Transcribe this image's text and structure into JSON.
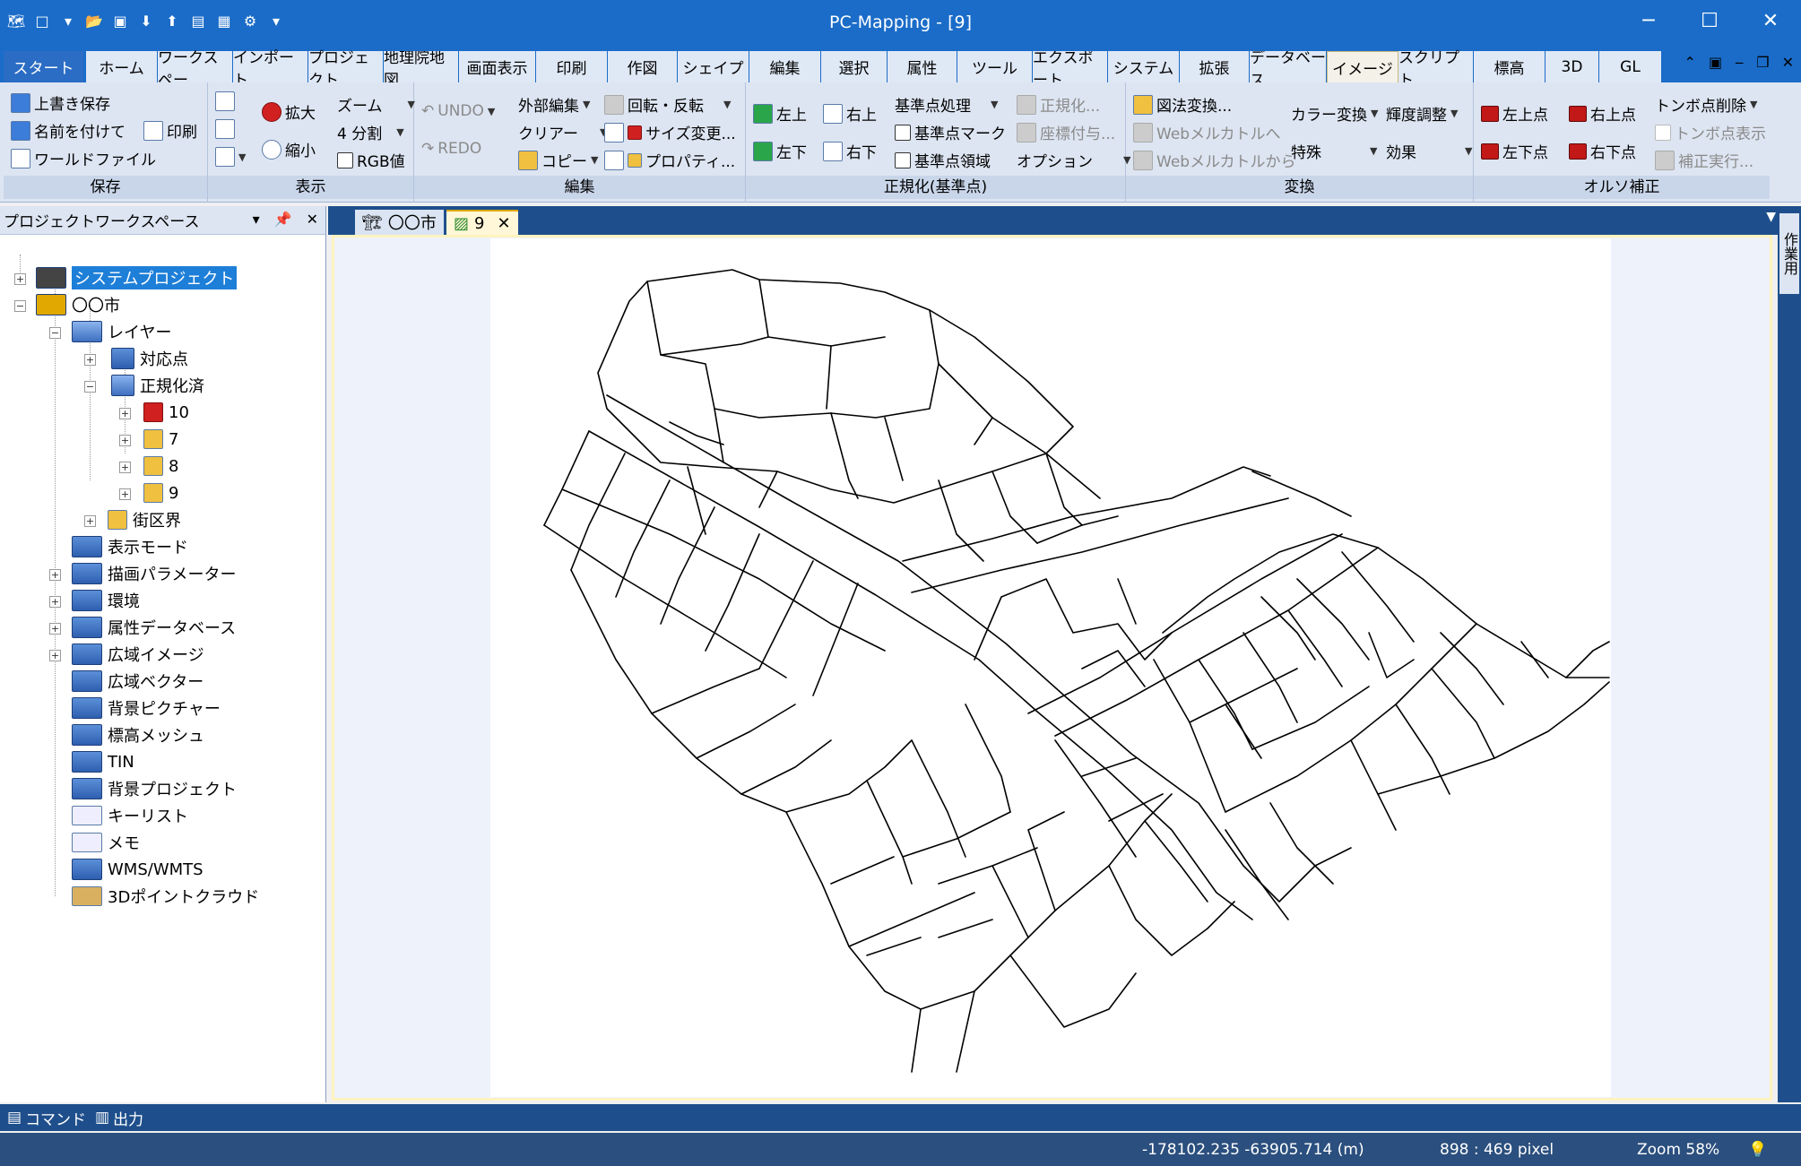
{
  "window": {
    "title": "PC-Mapping - [9]",
    "minimize": "─",
    "maximize": "☐",
    "close": "✕"
  },
  "ribbon_tabs": [
    "スタート",
    "ホーム",
    "ワークスペー",
    "インポート",
    "プロジェクト",
    "地理院地図",
    "画面表示",
    "印刷",
    "作図",
    "シェイプ",
    "編集",
    "選択",
    "属性",
    "ツール",
    "エクスポート",
    "システム",
    "拡張",
    "データベース",
    "イメージ",
    "スクリプト",
    "標高",
    "3D",
    "GL"
  ],
  "ribbon": {
    "save": {
      "title": "保存",
      "overwrite": "上書き保存",
      "save_as": "名前を付けて",
      "world_file": "ワールドファイル",
      "print": "印刷"
    },
    "display": {
      "title": "表示",
      "zoom_in": "拡大",
      "zoom_out": "縮小",
      "zoom": "ズーム",
      "split": "4 分割",
      "rgb": "RGB値"
    },
    "edit": {
      "title": "編集",
      "undo": "UNDO",
      "redo": "REDO",
      "external_edit": "外部編集",
      "clear": "クリアー",
      "copy": "コピー",
      "rotate": "回転・反転",
      "resize": "サイズ変更...",
      "property": "プロパティ..."
    },
    "normalize": {
      "title": "正規化(基準点)",
      "top_left": "左上",
      "bottom_left": "左下",
      "top_right": "右上",
      "bottom_right": "右下",
      "ref_processing": "基準点処理",
      "ref_mark": "基準点マーク",
      "ref_area": "基準点領域",
      "normalize": "正規化...",
      "coord_assign": "座標付与...",
      "option": "オプション"
    },
    "convert": {
      "title": "変換",
      "projection": "図法変換...",
      "to_web_mercator": "Webメルカトルへ",
      "from_web_mercator": "Webメルカトルから",
      "color_convert": "カラー変換",
      "special": "特殊",
      "brightness": "輝度調整",
      "effect": "効果"
    },
    "ortho": {
      "title": "オルソ補正",
      "top_left_pt": "左上点",
      "bottom_left_pt": "左下点",
      "top_right_pt": "右上点",
      "bottom_right_pt": "右下点",
      "delete_tonbo": "トンボ点削除",
      "show_tonbo": "トンボ点表示",
      "run_correction": "補正実行..."
    }
  },
  "workspace_panel": {
    "title": "プロジェクトワークスペース",
    "tree": [
      {
        "label": "システムプロジェクト",
        "selected": true
      },
      {
        "label": "〇〇市"
      },
      {
        "label": "レイヤー"
      },
      {
        "label": "対応点"
      },
      {
        "label": "正規化済"
      },
      {
        "label": "10"
      },
      {
        "label": "7"
      },
      {
        "label": "8"
      },
      {
        "label": "9"
      },
      {
        "label": "街区界"
      },
      {
        "label": "表示モード"
      },
      {
        "label": "描画パラメーター"
      },
      {
        "label": "環境"
      },
      {
        "label": "属性データベース"
      },
      {
        "label": "広域イメージ"
      },
      {
        "label": "広域ベクター"
      },
      {
        "label": "背景ピクチャー"
      },
      {
        "label": "標高メッシュ"
      },
      {
        "label": "TIN"
      },
      {
        "label": "背景プロジェクト"
      },
      {
        "label": "キーリスト"
      },
      {
        "label": "メモ"
      },
      {
        "label": "WMS/WMTS"
      },
      {
        "label": "3Dポイントクラウド"
      }
    ]
  },
  "doc_tabs": [
    {
      "label": "〇〇市"
    },
    {
      "label": "9"
    }
  ],
  "right_strip": "作業用",
  "bottom_tabs": [
    "コマンド",
    "出力"
  ],
  "status": {
    "coords": "-178102.235 -63905.714 (m)",
    "pixel": "898 :  469 pixel",
    "zoom": "Zoom  58%"
  },
  "colors": {
    "accent": "#1a6cc8",
    "ribbon_bg": "#dde5f2",
    "selected": "#1e7fd8"
  }
}
